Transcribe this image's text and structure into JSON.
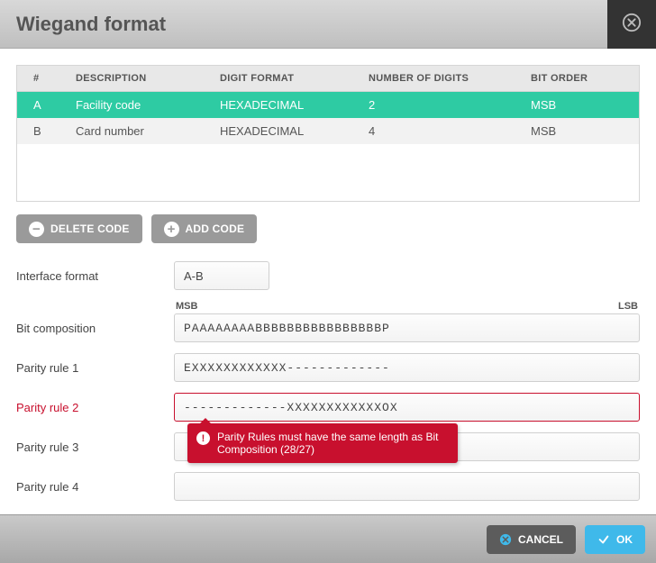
{
  "dialog": {
    "title": "Wiegand format"
  },
  "table": {
    "headers": {
      "num": "#",
      "description": "DESCRIPTION",
      "digit_format": "DIGIT FORMAT",
      "number_of_digits": "NUMBER OF DIGITS",
      "bit_order": "BIT ORDER"
    },
    "rows": [
      {
        "num": "A",
        "description": "Facility code",
        "digit_format": "HEXADECIMAL",
        "number_of_digits": "2",
        "bit_order": "MSB"
      },
      {
        "num": "B",
        "description": "Card number",
        "digit_format": "HEXADECIMAL",
        "number_of_digits": "4",
        "bit_order": "MSB"
      }
    ]
  },
  "buttons": {
    "delete_code": "DELETE CODE",
    "add_code": "ADD CODE",
    "cancel": "CANCEL",
    "ok": "OK"
  },
  "form": {
    "interface_format_label": "Interface format",
    "interface_format_value": "A-B",
    "msb_label": "MSB",
    "lsb_label": "LSB",
    "bit_composition_label": "Bit composition",
    "bit_composition_value": "PAAAAAAAABBBBBBBBBBBBBBBBP",
    "parity1_label": "Parity rule 1",
    "parity1_value": "EXXXXXXXXXXXX-------------",
    "parity2_label": "Parity rule 2",
    "parity2_value": "-------------XXXXXXXXXXXXOX",
    "parity2_error": "Parity Rules must have the same length as Bit Composition (28/27)",
    "parity3_label": "Parity rule 3",
    "parity3_value": "",
    "parity4_label": "Parity rule 4",
    "parity4_value": ""
  }
}
